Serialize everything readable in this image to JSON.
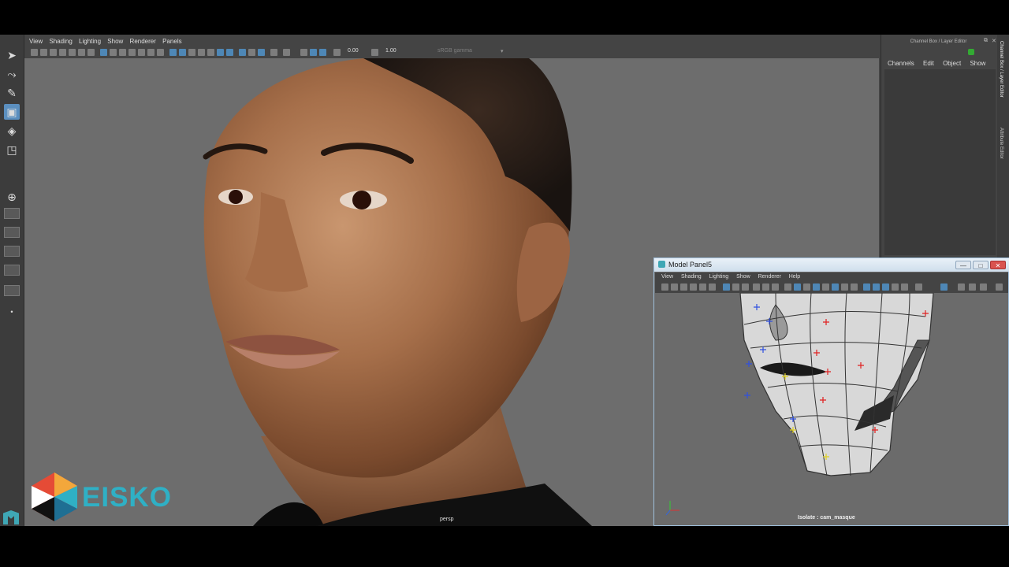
{
  "viewport": {
    "menu": [
      "View",
      "Shading",
      "Lighting",
      "Show",
      "Renderer",
      "Panels"
    ],
    "exposure": "0.00",
    "gamma": "1.00",
    "color_space": "sRGB gamma",
    "camera_label": "persp"
  },
  "channel_box": {
    "title": "Channel Box / Layer Editor",
    "menu": [
      "Channels",
      "Edit",
      "Object",
      "Show"
    ],
    "side_tabs": [
      "Channel Box / Layer Editor",
      "Attribute Editor"
    ]
  },
  "model_panel": {
    "title": "Model Panel5",
    "menu": [
      "View",
      "Shading",
      "Lighting",
      "Show",
      "Renderer",
      "Help"
    ],
    "isolate_label": "Isolate : cam_masque",
    "window_buttons": {
      "minimize": "—",
      "maximize": "□",
      "close": "✕"
    }
  },
  "branding": {
    "logo_text": "EISKO"
  },
  "colors": {
    "accent_blue": "#4e87b6",
    "eisko_cyan": "#2fb0c5",
    "viewport_bg": "#6d6d6d"
  }
}
